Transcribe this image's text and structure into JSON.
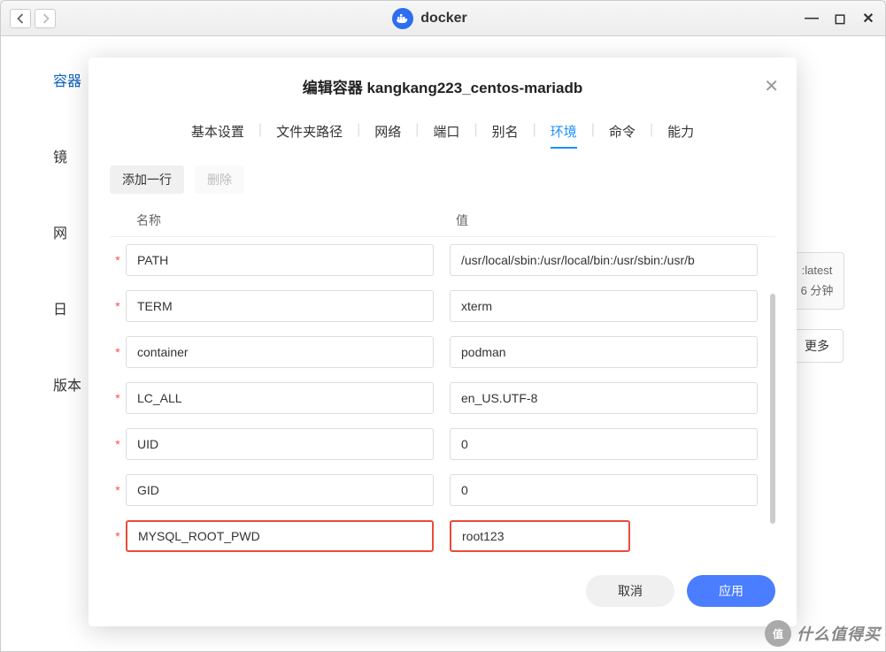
{
  "app": {
    "name": "docker"
  },
  "sidebar": {
    "items": [
      {
        "label": "容器"
      },
      {
        "label": "镜"
      },
      {
        "label": "网"
      },
      {
        "label": "日"
      },
      {
        "label": "版本"
      }
    ]
  },
  "background": {
    "tag_suffix": ":latest",
    "uptime": "6 分钟",
    "more": "更多"
  },
  "modal": {
    "title": "编辑容器 kangkang223_centos-mariadb",
    "tabs": [
      {
        "label": "基本设置"
      },
      {
        "label": "文件夹路径"
      },
      {
        "label": "网络"
      },
      {
        "label": "端口"
      },
      {
        "label": "别名"
      },
      {
        "label": "环境",
        "active": true
      },
      {
        "label": "命令"
      },
      {
        "label": "能力"
      }
    ],
    "actions": {
      "add": "添加一行",
      "delete": "删除"
    },
    "columns": {
      "name": "名称",
      "value": "值"
    },
    "rows": [
      {
        "name": "PATH",
        "value": "/usr/local/sbin:/usr/local/bin:/usr/sbin:/usr/b"
      },
      {
        "name": "TERM",
        "value": "xterm"
      },
      {
        "name": "container",
        "value": "podman"
      },
      {
        "name": "LC_ALL",
        "value": "en_US.UTF-8"
      },
      {
        "name": "UID",
        "value": "0"
      },
      {
        "name": "GID",
        "value": "0"
      },
      {
        "name": "MYSQL_ROOT_PWD",
        "value": "root123",
        "highlight": true
      }
    ],
    "footer": {
      "cancel": "取消",
      "apply": "应用"
    }
  },
  "watermark": {
    "badge": "值",
    "text": "什么值得买"
  }
}
